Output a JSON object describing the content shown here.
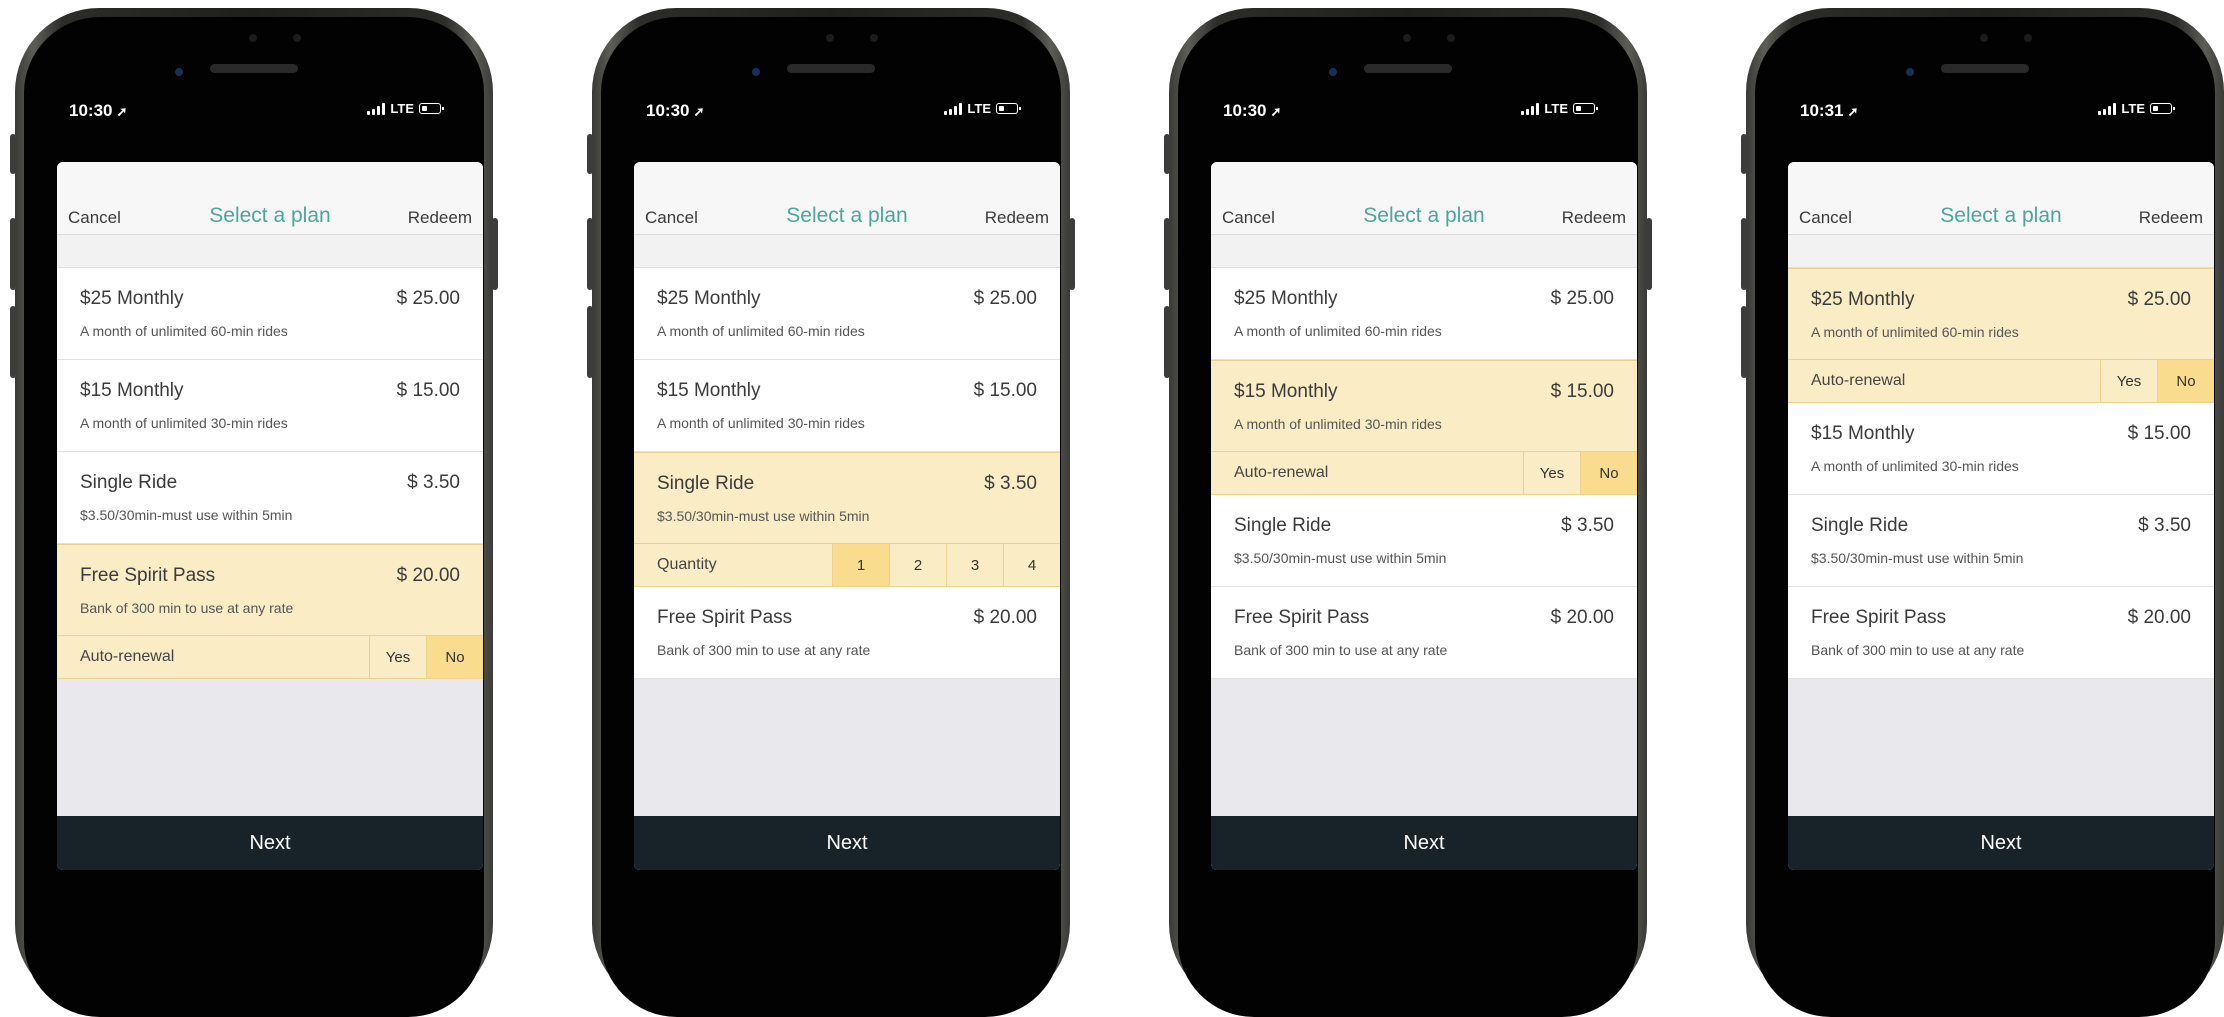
{
  "status": {
    "signal": "LTE"
  },
  "nav": {
    "cancel": "Cancel",
    "title": "Select a plan",
    "redeem": "Redeem"
  },
  "next_label": "Next",
  "plans": [
    {
      "name": "$25 Monthly",
      "price": "$ 25.00",
      "desc": "A month of unlimited 60-min rides"
    },
    {
      "name": "$15 Monthly",
      "price": "$ 15.00",
      "desc": "A month of unlimited 30-min rides"
    },
    {
      "name": "Single Ride",
      "price": "$ 3.50",
      "desc": "$3.50/30min-must use within 5min"
    },
    {
      "name": "Free Spirit Pass",
      "price": "$ 20.00",
      "desc": "Bank of 300 min to use at any rate"
    }
  ],
  "options": {
    "auto_renewal": "Auto-renewal",
    "yes": "Yes",
    "no": "No",
    "quantity": "Quantity",
    "quantities": [
      "1",
      "2",
      "3",
      "4"
    ]
  },
  "colors": {
    "accent": "#4aa79b",
    "selected_bg": "#faecc5",
    "active_option": "#f9dc8e",
    "next_bg": "#172328"
  },
  "screens": [
    {
      "time": "10:30",
      "selected_plan": "Free Spirit Pass",
      "option_type": "auto-renewal",
      "active_option": "No"
    },
    {
      "time": "10:30",
      "selected_plan": "Single Ride",
      "option_type": "quantity",
      "active_option": "1"
    },
    {
      "time": "10:30",
      "selected_plan": "$15 Monthly",
      "option_type": "auto-renewal",
      "active_option": "No"
    },
    {
      "time": "10:31",
      "selected_plan": "$25 Monthly",
      "option_type": "auto-renewal",
      "active_option": "No"
    }
  ]
}
